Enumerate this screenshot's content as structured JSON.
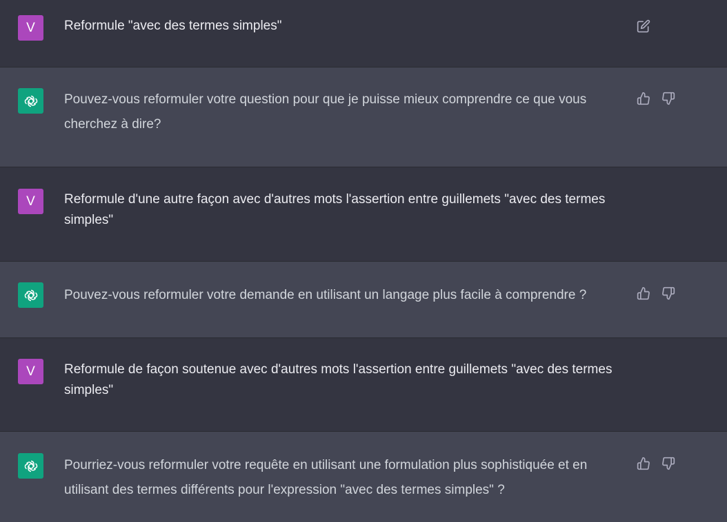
{
  "messages": [
    {
      "role": "user",
      "avatar_letter": "V",
      "text": "Reformule \"avec des termes simples\""
    },
    {
      "role": "assistant",
      "avatar_icon": "openai-logo-icon",
      "text": "Pouvez-vous reformuler votre question pour que je puisse mieux comprendre ce que vous cherchez à dire?"
    },
    {
      "role": "user",
      "avatar_letter": "V",
      "text": "Reformule d'une autre façon avec d'autres mots l'assertion entre guillemets  \"avec des termes simples\""
    },
    {
      "role": "assistant",
      "avatar_icon": "openai-logo-icon",
      "text": "Pouvez-vous reformuler votre demande en utilisant un langage plus facile à comprendre ?"
    },
    {
      "role": "user",
      "avatar_letter": "V",
      "text": "Reformule de façon soutenue avec d'autres mots l'assertion entre guillemets  \"avec des termes simples\""
    },
    {
      "role": "assistant",
      "avatar_icon": "openai-logo-icon",
      "text": "Pourriez-vous reformuler votre requête en utilisant une formulation plus sophistiquée et en utilisant des termes différents pour l'expression \"avec des termes simples\" ?"
    }
  ],
  "icons": {
    "edit": "edit-icon",
    "thumbs_up": "thumbs-up-icon",
    "thumbs_down": "thumbs-down-icon"
  },
  "colors": {
    "user_bg": "#343541",
    "assistant_bg": "#444654",
    "user_avatar": "#ab47bc",
    "assistant_avatar": "#10a37f",
    "icon": "#acacbe"
  }
}
